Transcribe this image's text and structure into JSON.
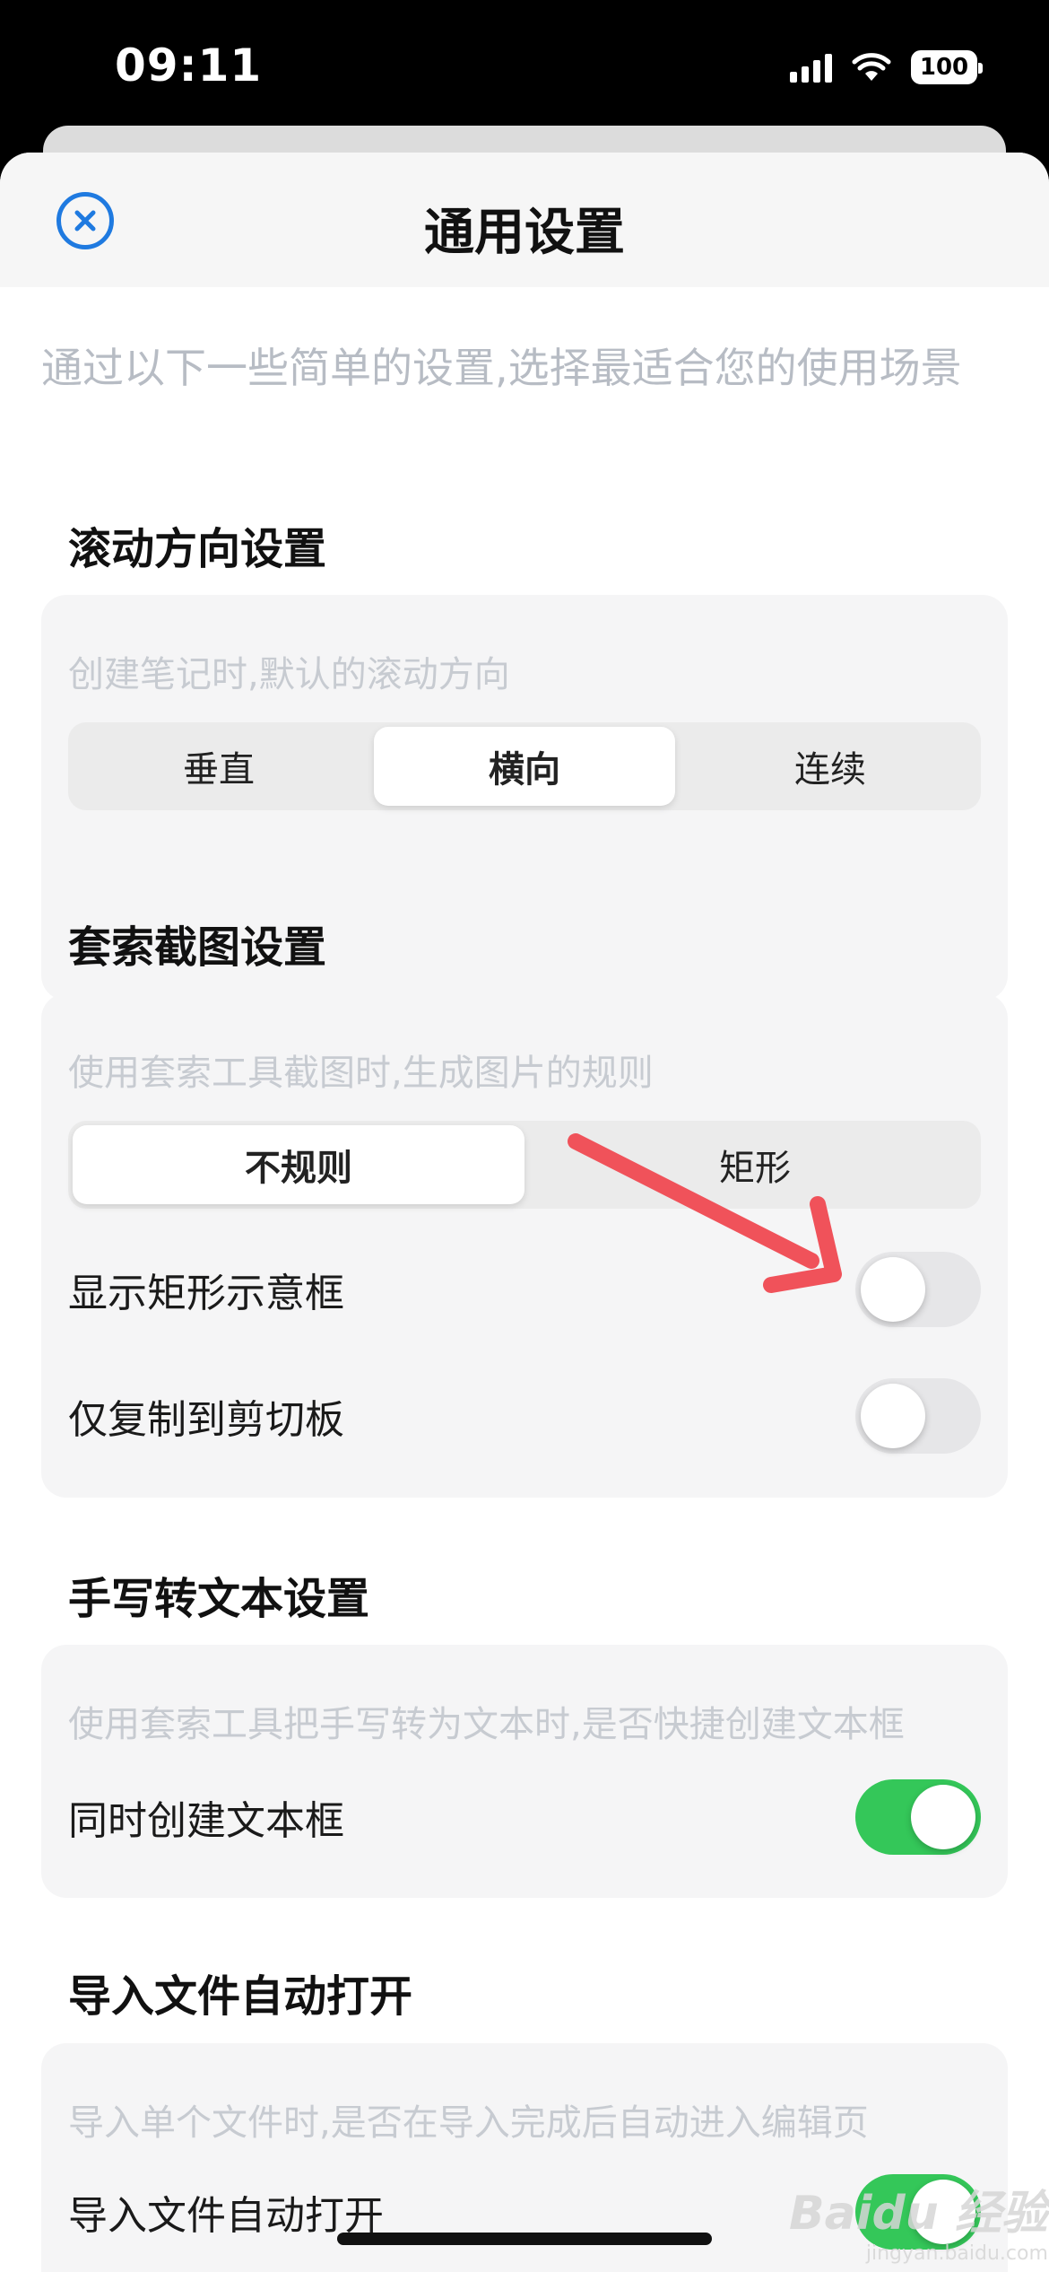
{
  "status_bar": {
    "time": "09:11",
    "battery": "100",
    "icons": [
      "signal-icon",
      "wifi-icon",
      "battery-icon"
    ]
  },
  "nav": {
    "title": "通用设置",
    "close_icon": "close-icon",
    "accent": "#1f7ae0"
  },
  "intro": "通过以下一些简单的设置,选择最适合您的使用场景",
  "scroll": {
    "title": "滚动方向设置",
    "hint": "创建笔记时,默认的滚动方向",
    "options": [
      "垂直",
      "横向",
      "连续"
    ],
    "selected": "横向"
  },
  "lasso": {
    "title": "套索截图设置",
    "hint": "使用套索工具截图时,生成图片的规则",
    "options": [
      "不规则",
      "矩形"
    ],
    "selected": "不规则",
    "toggles": [
      {
        "label": "显示矩形示意框",
        "on": false
      },
      {
        "label": "仅复制到剪切板",
        "on": false
      }
    ]
  },
  "handwriting": {
    "title": "手写转文本设置",
    "hint": "使用套索工具把手写转为文本时,是否快捷创建文本框",
    "toggles": [
      {
        "label": "同时创建文本框",
        "on": true
      }
    ]
  },
  "import": {
    "title": "导入文件自动打开",
    "hint": "导入单个文件时,是否在导入完成后自动进入编辑页",
    "toggles": [
      {
        "label": "导入文件自动打开",
        "on": true
      }
    ]
  },
  "colors": {
    "toggle_on": "#34c759",
    "toggle_off": "#e6e6e8",
    "annotation_arrow": "#f0525a"
  },
  "watermark": {
    "main": "Baidu 经验",
    "sub": "jingyan.baidu.com"
  }
}
